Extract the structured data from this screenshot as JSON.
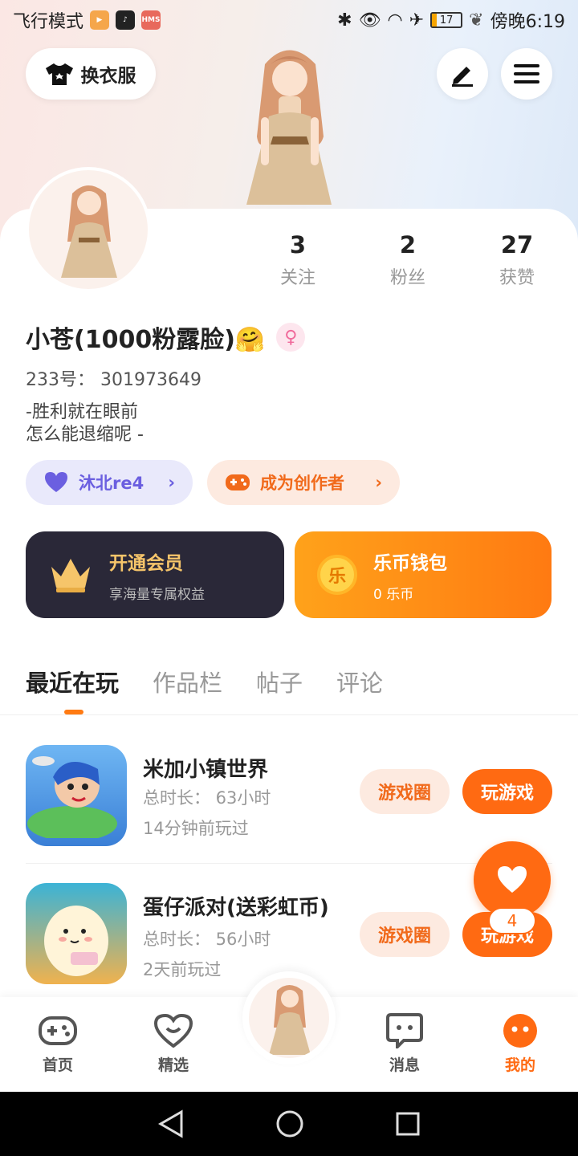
{
  "status_bar": {
    "mode": "飞行模式",
    "app_badge": "HMS",
    "battery": "17",
    "time": "傍晚6:19"
  },
  "header": {
    "outfit_label": "换衣服",
    "edit_icon": "pen-icon",
    "menu_icon": "hamburger-menu-icon"
  },
  "profile": {
    "stats": [
      {
        "num": "3",
        "label": "关注"
      },
      {
        "num": "2",
        "label": "粉丝"
      },
      {
        "num": "27",
        "label": "获赞"
      }
    ],
    "username": "小苍(1000粉露脸)🤗",
    "gender_symbol": "♀",
    "uid": "233号：  301973649",
    "bio_line1": "-胜利就在眼前",
    "bio_line2": "怎么能退缩呢 -",
    "tag_1": "沐北re4",
    "tag_2": "成为创作者"
  },
  "promos": {
    "vip_title": "开通会员",
    "vip_sub": "享海量专属权益",
    "coin_title": "乐币钱包",
    "coin_sub": "0 乐币",
    "coin_glyph": "乐"
  },
  "tabs": [
    "最近在玩",
    "作品栏",
    "帖子",
    "评论"
  ],
  "games": [
    {
      "name": "米加小镇世界",
      "total": "总时长：  63小时",
      "last": "14分钟前玩过",
      "circle_btn": "游戏圈",
      "play_btn": "玩游戏"
    },
    {
      "name": "蛋仔派对(送彩虹币)",
      "total": "总时长：  56小时",
      "last": "2天前玩过",
      "circle_btn": "游戏圈",
      "play_btn": "玩游戏"
    }
  ],
  "fab": {
    "count": "4"
  },
  "bottom_nav": [
    {
      "label": "首页",
      "icon": "gamepad-icon"
    },
    {
      "label": "精选",
      "icon": "heart-chat-icon"
    },
    {
      "label": "消息",
      "icon": "message-icon"
    },
    {
      "label": "我的",
      "icon": "profile-face-icon"
    }
  ],
  "colors": {
    "accent": "#ff6a12",
    "tag_purple": "#6b5fe0",
    "vip_bg": "#2a2838"
  }
}
